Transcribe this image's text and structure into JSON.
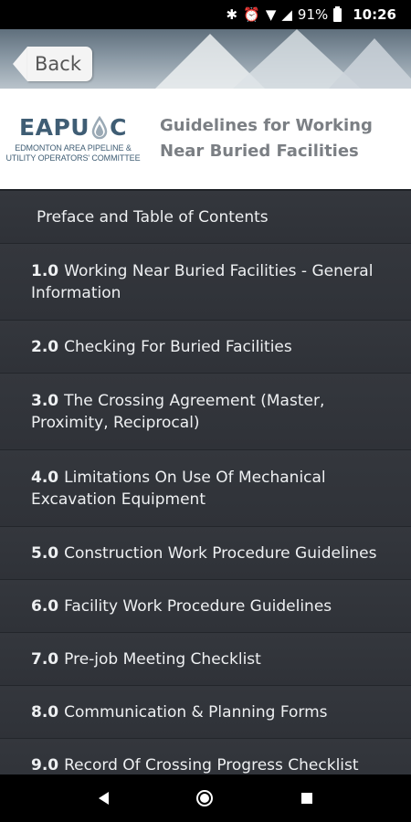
{
  "status_bar": {
    "battery": "91%",
    "time": "10:26",
    "icons": [
      "bluetooth-icon",
      "alarm-icon",
      "wifi-icon",
      "signal-icon",
      "battery-icon"
    ]
  },
  "header": {
    "back_label": "Back"
  },
  "branding": {
    "logo_letters_left": "EAPU",
    "logo_letters_right": "C",
    "logo_sub_line1": "EDMONTON AREA PIPELINE &",
    "logo_sub_line2": "UTILITY OPERATORS' COMMITTEE",
    "title": "Guidelines for Working Near Buried Facilities"
  },
  "toc": [
    {
      "num": "",
      "label": "Preface and Table of Contents"
    },
    {
      "num": "1.0",
      "label": "Working Near Buried Facilities - General Information"
    },
    {
      "num": "2.0",
      "label": "Checking For Buried Facilities"
    },
    {
      "num": "3.0",
      "label": "The Crossing Agreement (Master, Proximity, Reciprocal)"
    },
    {
      "num": "4.0",
      "label": "Limitations On Use Of Mechanical Excavation Equipment"
    },
    {
      "num": "5.0",
      "label": "Construction Work Procedure Guidelines"
    },
    {
      "num": "6.0",
      "label": "Facility Work Procedure Guidelines"
    },
    {
      "num": "7.0",
      "label": "Pre-job Meeting Checklist"
    },
    {
      "num": "8.0",
      "label": "Communication & Planning Forms"
    },
    {
      "num": "9.0",
      "label": "Record Of Crossing Progress Checklist"
    }
  ],
  "colors": {
    "list_bg": "#2e3137",
    "logo_blue": "#3f5d74",
    "title_gray": "#7b7f84"
  }
}
